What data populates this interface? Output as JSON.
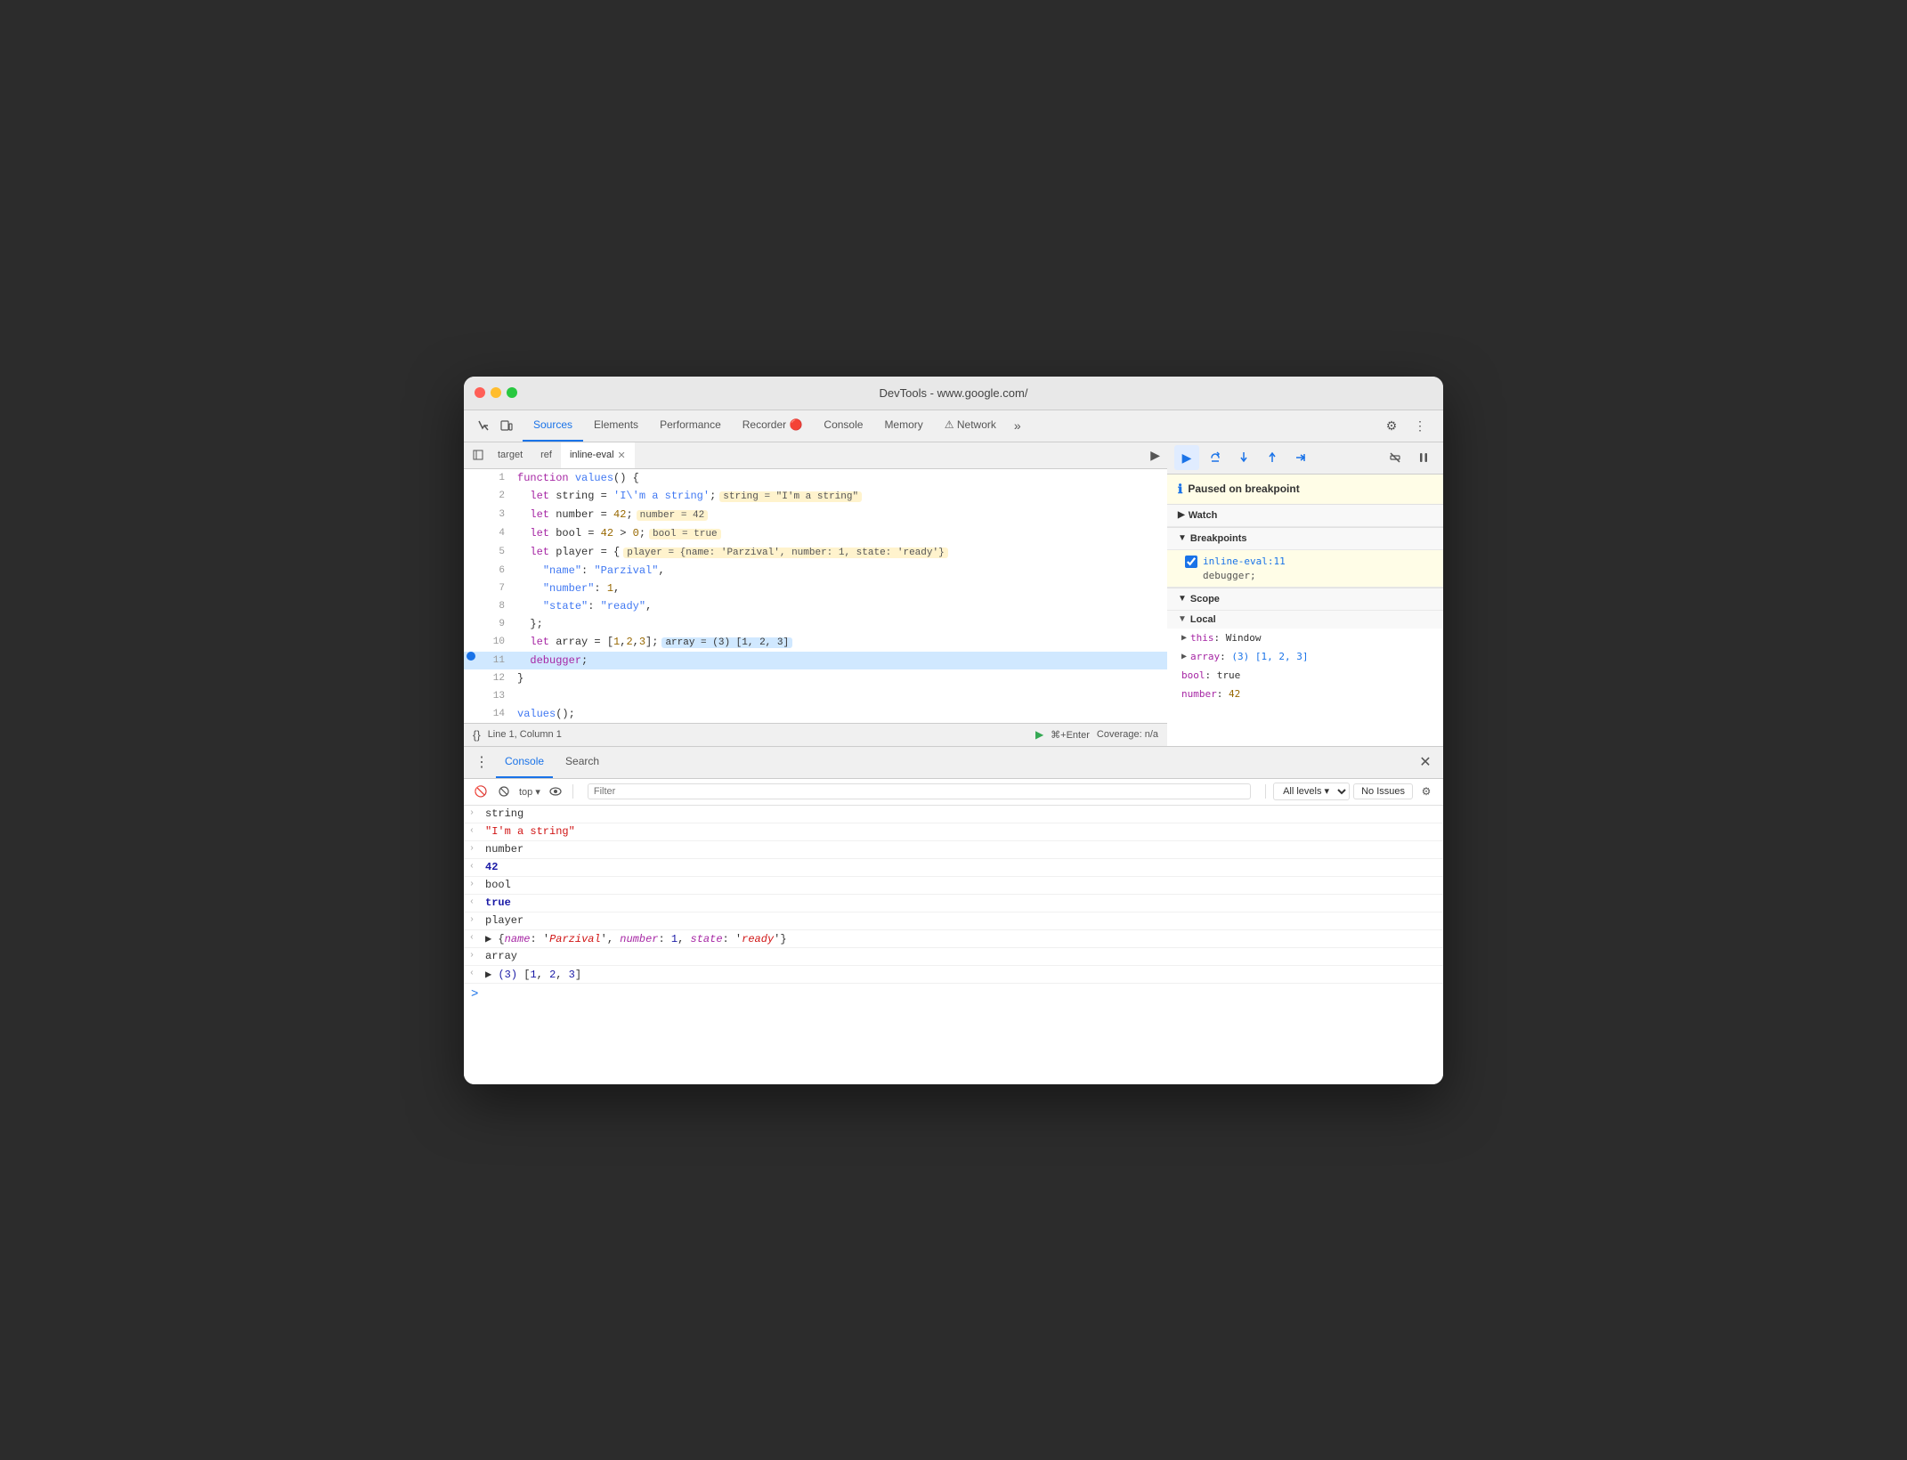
{
  "window": {
    "title": "DevTools - www.google.com/"
  },
  "tabs": {
    "items": [
      {
        "label": "Sources",
        "active": true
      },
      {
        "label": "Elements"
      },
      {
        "label": "Performance"
      },
      {
        "label": "Recorder 🔴"
      },
      {
        "label": "Console"
      },
      {
        "label": "Memory"
      },
      {
        "label": "⚠ Network"
      }
    ],
    "more": "»",
    "settings_icon": "⚙",
    "more_icon": "⋮"
  },
  "source_tabs": {
    "items": [
      {
        "label": "target"
      },
      {
        "label": "ref"
      },
      {
        "label": "inline-eval",
        "active": true,
        "closeable": true
      }
    ]
  },
  "code": {
    "lines": [
      {
        "num": 1,
        "content": "function values() {"
      },
      {
        "num": 2,
        "content": "  let string = 'I\\'m a string';",
        "inline_val": "string = \"I'm a string\""
      },
      {
        "num": 3,
        "content": "  let number = 42;",
        "inline_val": "number = 42"
      },
      {
        "num": 4,
        "content": "  let bool = 42 > 0;",
        "inline_val": "bool = true"
      },
      {
        "num": 5,
        "content": "  let player = {  player = {name: 'Parzival', number: 1, state: 'ready'}"
      },
      {
        "num": 6,
        "content": "    \"name\": \"Parzival\","
      },
      {
        "num": 7,
        "content": "    \"number\": 1,"
      },
      {
        "num": 8,
        "content": "    \"state\": \"ready\","
      },
      {
        "num": 9,
        "content": "  };"
      },
      {
        "num": 10,
        "content": "  let array = [1,2,3];",
        "inline_val": "array = (3) [1, 2, 3]"
      },
      {
        "num": 11,
        "content": "  debugger;",
        "highlighted": true,
        "breakpoint": true
      },
      {
        "num": 12,
        "content": "}"
      },
      {
        "num": 13,
        "content": ""
      },
      {
        "num": 14,
        "content": "values();"
      }
    ]
  },
  "status_bar": {
    "curly_braces": "{}",
    "position": "Line 1, Column 1",
    "run_icon": "▶",
    "shortcut": "⌘+Enter",
    "coverage": "Coverage: n/a"
  },
  "debugger": {
    "paused_message": "Paused on breakpoint",
    "buttons": {
      "resume": "▶",
      "step_over": "↺",
      "step_into": "↓",
      "step_out": "↑",
      "step": "→",
      "deactivate": "⊘",
      "pause_on_exceptions": "⏸"
    },
    "watch_label": "Watch",
    "breakpoints_label": "Breakpoints",
    "breakpoint_file": "inline-eval:11",
    "breakpoint_code": "debugger;",
    "scope_label": "Scope",
    "local_label": "Local",
    "scope_items": [
      {
        "label": "this: Window"
      },
      {
        "label": "array: (3) [1, 2, 3]"
      },
      {
        "label": "bool: true"
      },
      {
        "label": "number: 42"
      }
    ]
  },
  "console": {
    "tabs": [
      {
        "label": "Console",
        "active": true
      },
      {
        "label": "Search"
      }
    ],
    "toolbar": {
      "filter_placeholder": "Filter",
      "level_label": "All levels ▾",
      "issues_label": "No Issues"
    },
    "entries": [
      {
        "type": "input",
        "text": "string"
      },
      {
        "type": "output_string",
        "text": "\"I'm a string\""
      },
      {
        "type": "input",
        "text": "number"
      },
      {
        "type": "output_num",
        "text": "42"
      },
      {
        "type": "input",
        "text": "bool"
      },
      {
        "type": "output_bool",
        "text": "true"
      },
      {
        "type": "input",
        "text": "player"
      },
      {
        "type": "output_obj",
        "text": "▶ {name: 'Parzival', number: 1, state: 'ready'}"
      },
      {
        "type": "input",
        "text": "array"
      },
      {
        "type": "output_arr",
        "text": "▶ (3) [1, 2, 3]"
      }
    ],
    "prompt_icon": ">"
  }
}
